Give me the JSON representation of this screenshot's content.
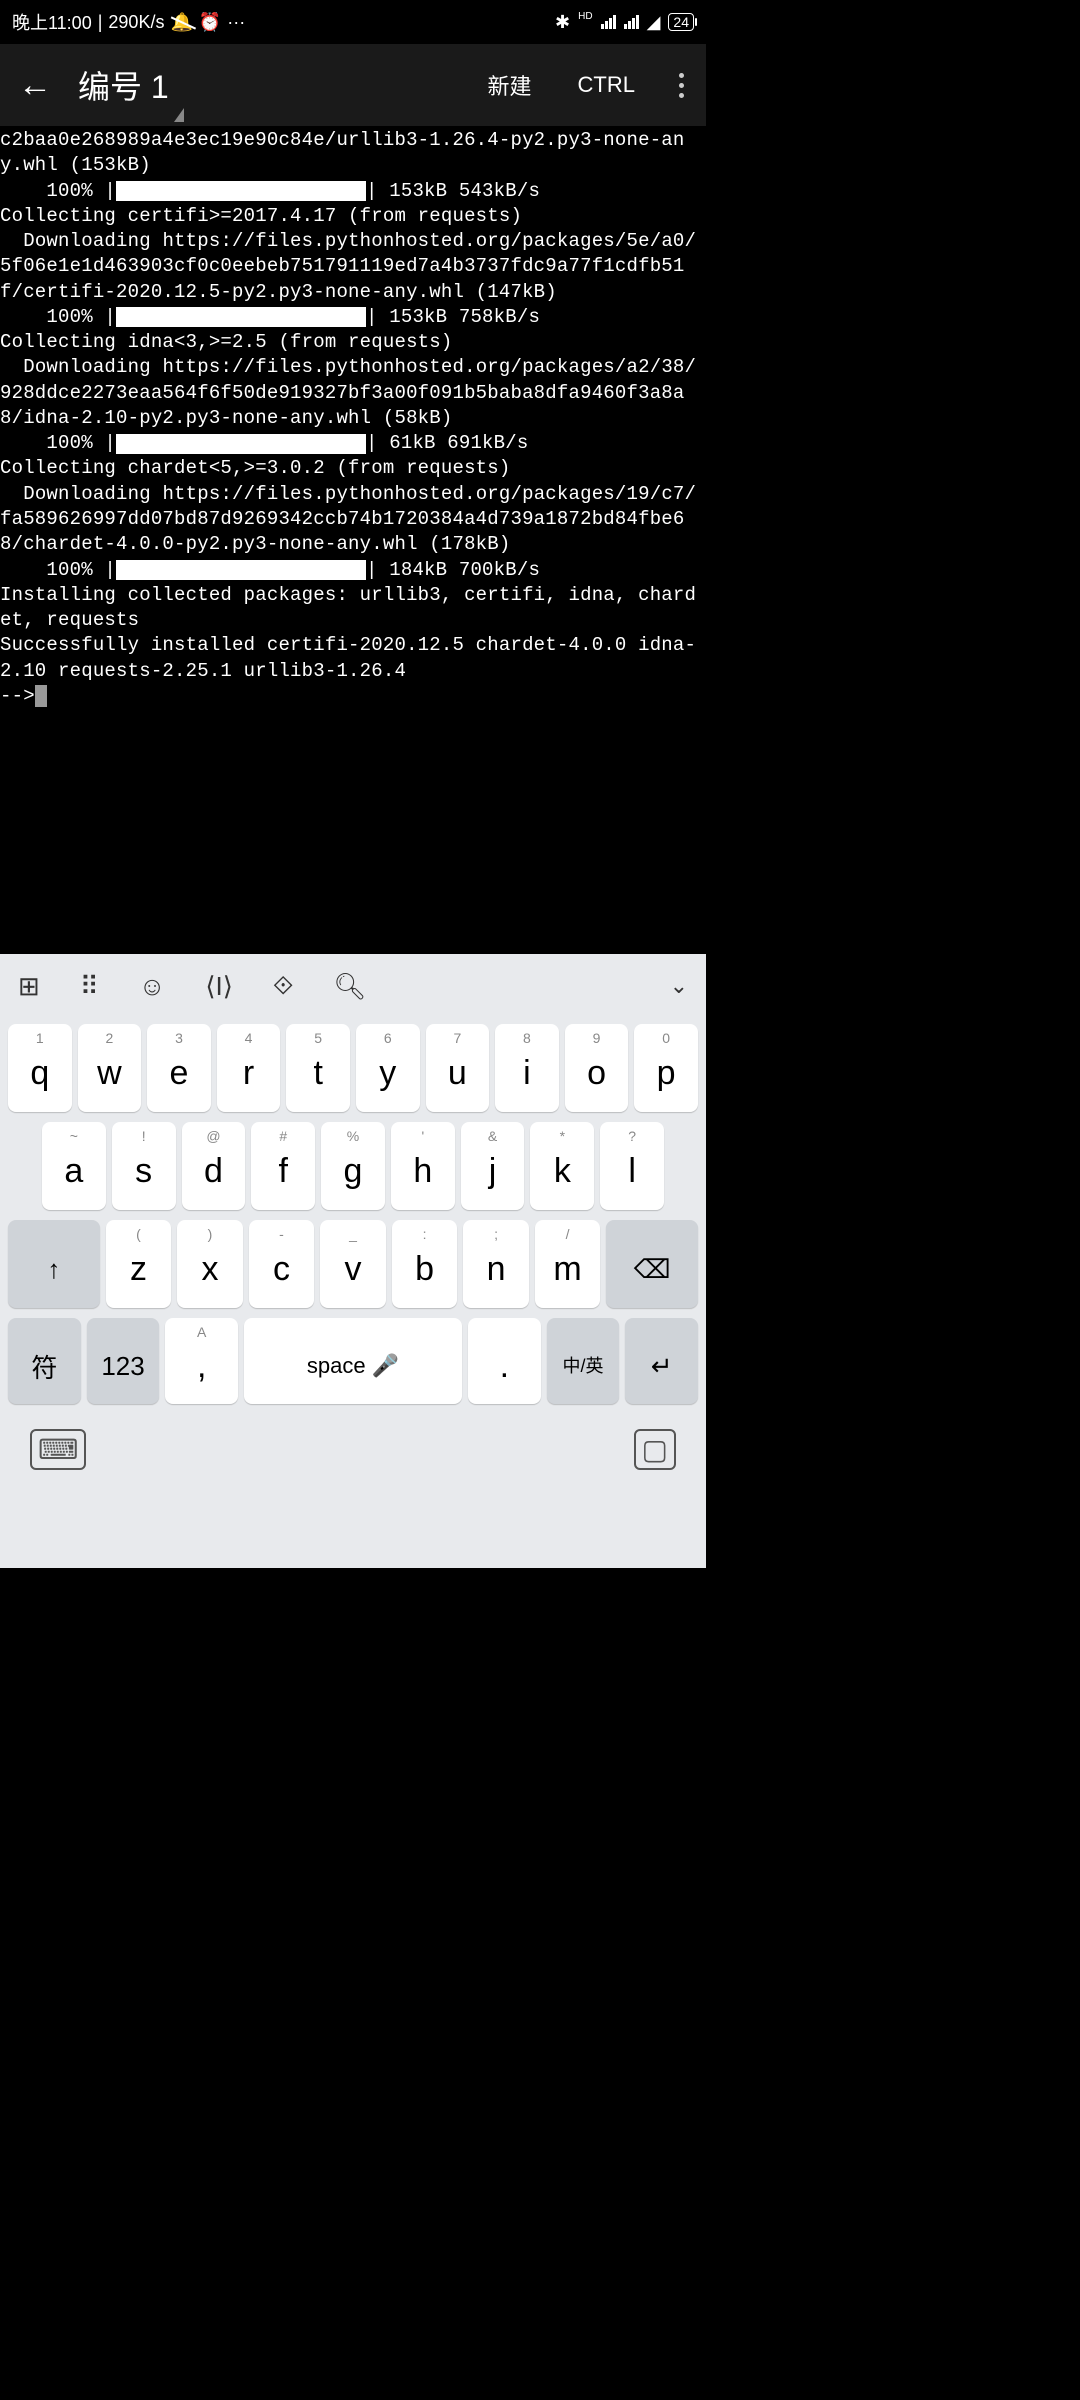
{
  "status": {
    "time": "晚上11:00",
    "speed": "290K/s",
    "battery": "24",
    "hd": "HD"
  },
  "appbar": {
    "title": "编号 1",
    "new_btn": "新建",
    "ctrl_btn": "CTRL"
  },
  "terminal": {
    "lines": [
      "c2baa0e268989a4e3ec19e90c84e/urllib3-1.26.4-py2.py3-none-any.whl (153kB)"
    ],
    "prog1": {
      "pct": "    100% |",
      "end": "| 153kB 543kB/s"
    },
    "lines2": [
      "Collecting certifi>=2017.4.17 (from requests)",
      "  Downloading https://files.pythonhosted.org/packages/5e/a0/5f06e1e1d463903cf0c0eebeb751791119ed7a4b3737fdc9a77f1cdfb51f/certifi-2020.12.5-py2.py3-none-any.whl (147kB)"
    ],
    "prog2": {
      "pct": "    100% |",
      "end": "| 153kB 758kB/s"
    },
    "lines3": [
      "Collecting idna<3,>=2.5 (from requests)",
      "  Downloading https://files.pythonhosted.org/packages/a2/38/928ddce2273eaa564f6f50de919327bf3a00f091b5baba8dfa9460f3a8a8/idna-2.10-py2.py3-none-any.whl (58kB)"
    ],
    "prog3": {
      "pct": "    100% |",
      "end": "| 61kB 691kB/s"
    },
    "lines4": [
      "Collecting chardet<5,>=3.0.2 (from requests)",
      "  Downloading https://files.pythonhosted.org/packages/19/c7/fa589626997dd07bd87d9269342ccb74b1720384a4d739a1872bd84fbe68/chardet-4.0.0-py2.py3-none-any.whl (178kB)"
    ],
    "prog4": {
      "pct": "    100% |",
      "end": "| 184kB 700kB/s"
    },
    "lines5": [
      "Installing collected packages: urllib3, certifi, idna, chardet, requests",
      "Successfully installed certifi-2020.12.5 chardet-4.0.0 idna-2.10 requests-2.25.1 urllib3-1.26.4",
      "-->"
    ]
  },
  "keyboard": {
    "row1": [
      {
        "s": "1",
        "m": "q"
      },
      {
        "s": "2",
        "m": "w"
      },
      {
        "s": "3",
        "m": "e"
      },
      {
        "s": "4",
        "m": "r"
      },
      {
        "s": "5",
        "m": "t"
      },
      {
        "s": "6",
        "m": "y"
      },
      {
        "s": "7",
        "m": "u"
      },
      {
        "s": "8",
        "m": "i"
      },
      {
        "s": "9",
        "m": "o"
      },
      {
        "s": "0",
        "m": "p"
      }
    ],
    "row2": [
      {
        "s": "~",
        "m": "a"
      },
      {
        "s": "!",
        "m": "s"
      },
      {
        "s": "@",
        "m": "d"
      },
      {
        "s": "#",
        "m": "f"
      },
      {
        "s": "%",
        "m": "g"
      },
      {
        "s": "'",
        "m": "h"
      },
      {
        "s": "&",
        "m": "j"
      },
      {
        "s": "*",
        "m": "k"
      },
      {
        "s": "?",
        "m": "l"
      }
    ],
    "row3": [
      {
        "s": "(",
        "m": "z"
      },
      {
        "s": ")",
        "m": "x"
      },
      {
        "s": "-",
        "m": "c"
      },
      {
        "s": "_",
        "m": "v"
      },
      {
        "s": ":",
        "m": "b"
      },
      {
        "s": ";",
        "m": "n"
      },
      {
        "s": "/",
        "m": "m"
      }
    ],
    "row4": {
      "sym": "符",
      "num": "123",
      "comma": ",",
      "comma_sub": "A",
      "space": "space",
      "period": ".",
      "lang": "中/英"
    }
  }
}
